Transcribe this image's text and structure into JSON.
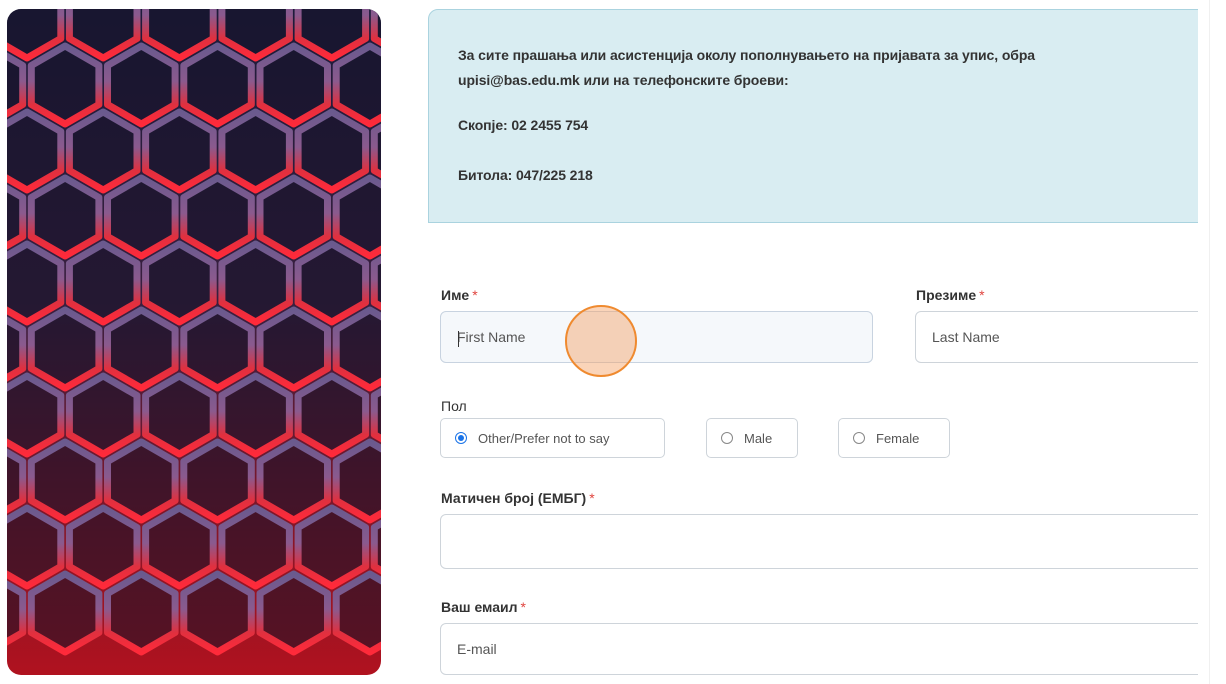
{
  "colors": {
    "accent": "#1a73e8",
    "info_bg": "#d9edf2",
    "required": "#e0443e",
    "click_highlight": "#ef8a2f"
  },
  "info": {
    "line1": "За сите прашања или асистенција околу пополнувањето на пријавата за упис, обра",
    "line2": "upisi@bas.edu.mk или на телефонските броеви:",
    "skopje": "Скопје: 02 2455 754",
    "bitola": "Битола: 047/225 218"
  },
  "form": {
    "first_name": {
      "label": "Име",
      "required": "*",
      "placeholder": "First Name"
    },
    "last_name": {
      "label": "Презиме",
      "required": "*",
      "placeholder": "Last Name"
    },
    "gender": {
      "label": "Пол",
      "options": [
        {
          "label": "Other/Prefer not to say",
          "checked": true
        },
        {
          "label": "Male",
          "checked": false
        },
        {
          "label": "Female",
          "checked": false
        }
      ]
    },
    "embg": {
      "label": "Матичен број (ЕМБГ)",
      "required": "*",
      "placeholder": ""
    },
    "email": {
      "label": "Ваш емаил",
      "required": "*",
      "placeholder": "E-mail"
    }
  }
}
